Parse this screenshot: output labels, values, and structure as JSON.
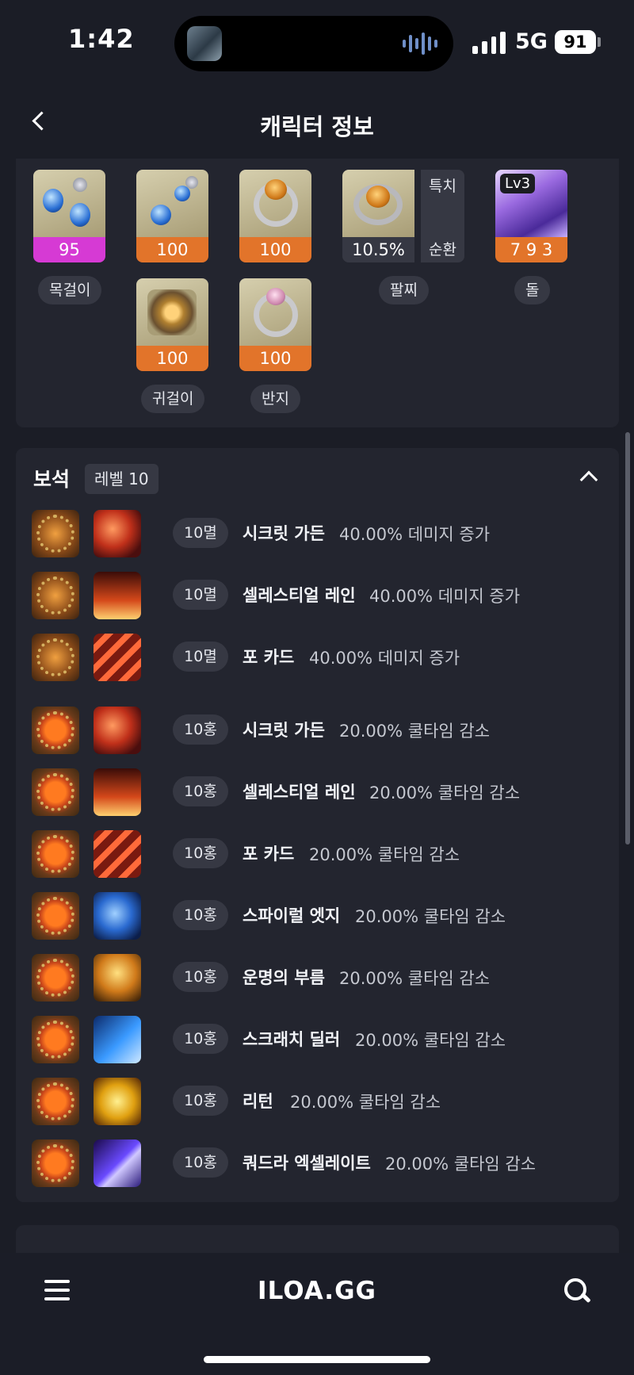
{
  "status": {
    "time": "1:42",
    "network": "5G",
    "battery": "91"
  },
  "header": {
    "title": "캐릭터 정보"
  },
  "accessories": {
    "necklace": {
      "value": "95",
      "label": "목걸이"
    },
    "earring_top": {
      "value": "100"
    },
    "ring_top": {
      "value": "100"
    },
    "earring_bottom": {
      "value": "100",
      "label": "귀걸이"
    },
    "ring_bottom": {
      "value": "100",
      "label": "반지"
    },
    "bracelet": {
      "value": "10.5%",
      "label": "팔찌",
      "stat1": "특치",
      "stat2": "순환"
    },
    "stone": {
      "level": "Lv3",
      "value": "7 9 3",
      "label": "돌"
    }
  },
  "gems": {
    "title": "보석",
    "level": "레벨 10",
    "rows": [
      {
        "grade": "10멸",
        "skill": "시크릿 가든",
        "effect": "40.00% 데미지 증가"
      },
      {
        "grade": "10멸",
        "skill": "셀레스티얼 레인",
        "effect": "40.00% 데미지 증가"
      },
      {
        "grade": "10멸",
        "skill": "포 카드",
        "effect": "40.00% 데미지 증가"
      },
      {
        "grade": "10홍",
        "skill": "시크릿 가든",
        "effect": "20.00% 쿨타임 감소"
      },
      {
        "grade": "10홍",
        "skill": "셀레스티얼 레인",
        "effect": "20.00% 쿨타임 감소"
      },
      {
        "grade": "10홍",
        "skill": "포 카드",
        "effect": "20.00% 쿨타임 감소"
      },
      {
        "grade": "10홍",
        "skill": "스파이럴 엣지",
        "effect": "20.00% 쿨타임 감소"
      },
      {
        "grade": "10홍",
        "skill": "운명의 부름",
        "effect": "20.00% 쿨타임 감소"
      },
      {
        "grade": "10홍",
        "skill": "스크래치 딜러",
        "effect": "20.00% 쿨타임 감소"
      },
      {
        "grade": "10홍",
        "skill": "리턴",
        "effect": "20.00% 쿨타임 감소"
      },
      {
        "grade": "10홍",
        "skill": "쿼드라 엑셀레이트",
        "effect": "20.00% 쿨타임 감소"
      }
    ]
  },
  "bottom": {
    "brand": "ILOA.GG"
  }
}
